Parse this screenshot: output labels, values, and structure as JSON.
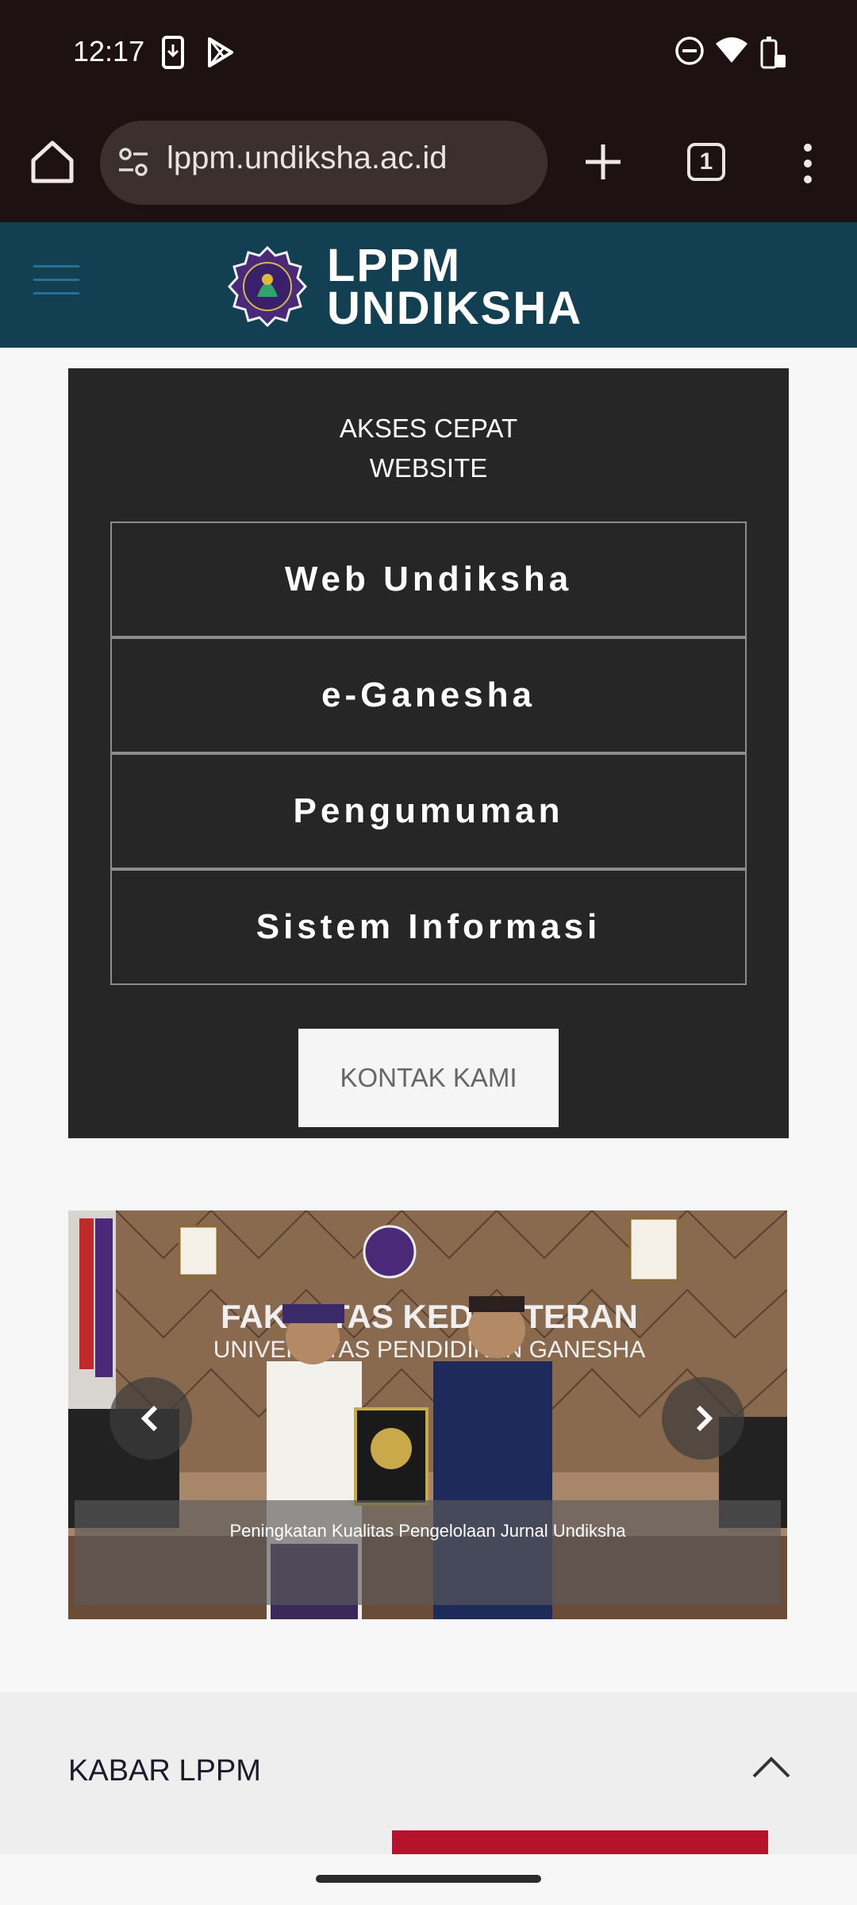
{
  "status": {
    "time": "12:17",
    "icons": [
      "download-icon",
      "play-store-icon",
      "dnd-icon",
      "wifi-icon",
      "battery-icon"
    ]
  },
  "browser": {
    "url": "lppm.undiksha.ac.id",
    "tab_count": "1"
  },
  "site": {
    "logo_line1": "LPPM",
    "logo_line2": "UNDIKSHA"
  },
  "quick_access": {
    "title_line1": "AKSES CEPAT",
    "title_line2": "WEBSITE",
    "links": [
      "Web Undiksha",
      "e-Ganesha",
      "Pengumuman",
      "Sistem Informasi"
    ],
    "contact_label": "KONTAK KAMI"
  },
  "slider": {
    "caption": "Peningkatan Kualitas Pengelolaan Jurnal Undiksha",
    "banner_line1": "FAKULTAS KEDOKTERAN",
    "banner_line2": "UNIVERSITAS PENDIDIKAN GANESHA"
  },
  "section": {
    "title": "KABAR LPPM"
  },
  "colors": {
    "header_bg": "#133f53",
    "panel_bg": "#262626",
    "accent_red": "#b5122b"
  }
}
